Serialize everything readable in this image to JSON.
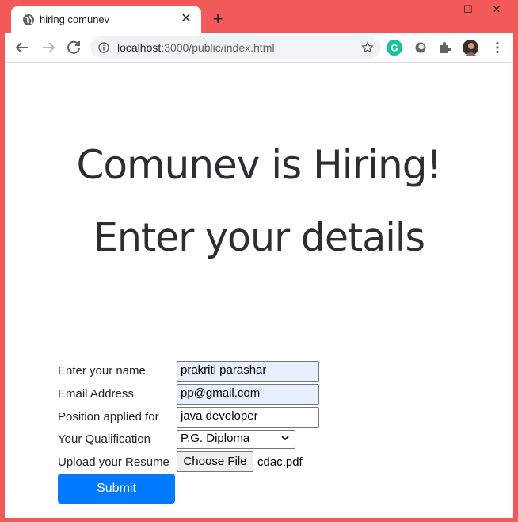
{
  "browser": {
    "tab_title": "hiring comunev",
    "url_host": "localhost",
    "url_path": ":3000/public/index.html",
    "window_controls": {
      "minimize": "–",
      "maximize": "☐",
      "close": "✕"
    },
    "newtab_symbol": "+",
    "tab_close_symbol": "✕"
  },
  "page": {
    "title": "Comunev is Hiring!",
    "subtitle": "Enter your details"
  },
  "form": {
    "name_label": "Enter your name",
    "name_value": "prakriti parashar",
    "email_label": "Email Address",
    "email_value": "pp@gmail.com",
    "position_label": "Position applied for",
    "position_value": "java developer",
    "qualification_label": "Your Qualification",
    "qualification_value": "P.G. Diploma",
    "resume_label": "Upload your Resume",
    "choose_file_label": "Choose File",
    "file_name": "cdac.pdf",
    "submit_label": "Submit"
  },
  "colors": {
    "frame": "#f25a5a",
    "primary_button": "#007bff",
    "autofill": "#e8f0fe"
  }
}
